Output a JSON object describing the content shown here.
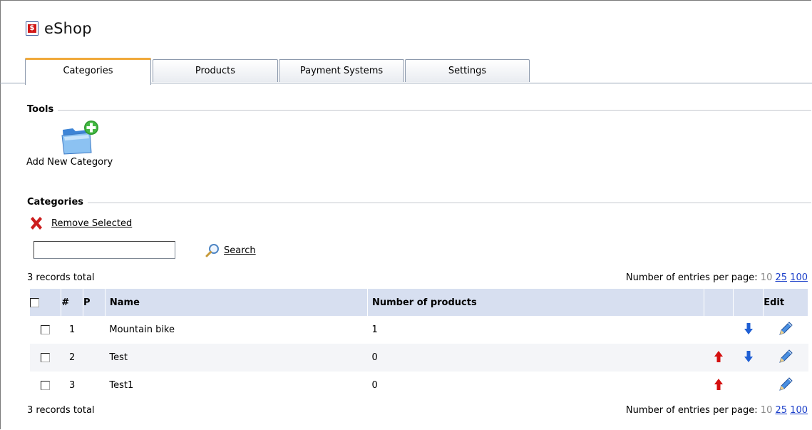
{
  "app": {
    "title": "eShop",
    "logo_glyph": "$"
  },
  "tabs": [
    {
      "label": "Categories",
      "active": true
    },
    {
      "label": "Products",
      "active": false
    },
    {
      "label": "Payment Systems",
      "active": false
    },
    {
      "label": "Settings",
      "active": false
    }
  ],
  "tools": {
    "title": "Tools",
    "add_category": {
      "label": "Add New Category",
      "icon": "folder-add-icon"
    }
  },
  "categories": {
    "title": "Categories",
    "remove_selected": "Remove Selected",
    "search": {
      "value": "",
      "placeholder": "",
      "label": "Search"
    },
    "records_total": "3 records total",
    "per_page": {
      "label": "Number of entries per page:",
      "current": "10",
      "options": [
        "25",
        "100"
      ]
    },
    "columns": {
      "num": "#",
      "p": "P",
      "name": "Name",
      "count": "Number of products",
      "edit": "Edit"
    },
    "rows": [
      {
        "num": "1",
        "name": "Mountain bike",
        "count": "1",
        "can_up": false,
        "can_down": true
      },
      {
        "num": "2",
        "name": "Test",
        "count": "0",
        "can_up": true,
        "can_down": true
      },
      {
        "num": "3",
        "name": "Test1",
        "count": "0",
        "can_up": true,
        "can_down": false
      }
    ]
  },
  "colors": {
    "active_tab_accent": "#f0a93a",
    "table_header": "#d7dff0",
    "link": "#1a3ec9",
    "arrow_up": "#d40f0f",
    "arrow_down": "#1f5fd4",
    "remove_icon": "#cc1d1d"
  }
}
